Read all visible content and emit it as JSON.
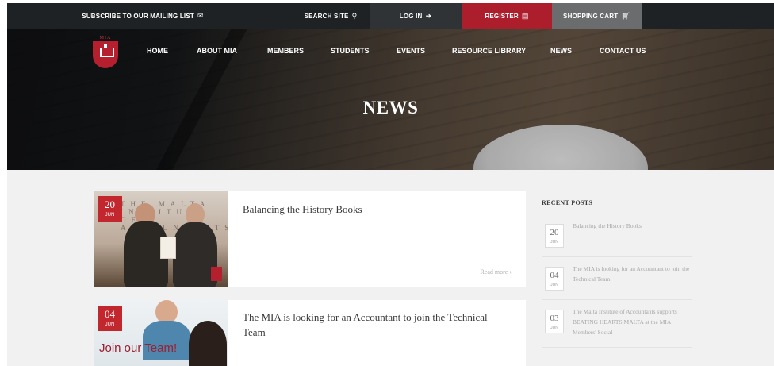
{
  "topbar": {
    "subscribe_label": "SUBSCRIBE TO OUR MAILING LIST",
    "subscribe_icon": "envelope-icon",
    "search_label": "SEARCH SITE",
    "search_icon": "search-icon",
    "login_label": "LOG IN",
    "login_icon": "login-icon",
    "register_label": "REGISTER",
    "register_icon": "id-card-icon",
    "cart_label": "SHOPPING CART",
    "cart_icon": "cart-icon",
    "colors": {
      "bar": "#1f2224",
      "register": "#ad1e2d",
      "cart": "#6a6c6e"
    }
  },
  "logo": {
    "text": "MIA"
  },
  "nav": {
    "items": [
      {
        "label": "HOME"
      },
      {
        "label": "ABOUT MIA"
      },
      {
        "label": "MEMBERS"
      },
      {
        "label": "STUDENTS"
      },
      {
        "label": "EVENTS"
      },
      {
        "label": "RESOURCE LIBRARY"
      },
      {
        "label": "NEWS"
      },
      {
        "label": "CONTACT US"
      }
    ]
  },
  "hero": {
    "title": "NEWS"
  },
  "posts": [
    {
      "day": "20",
      "month": "JUN",
      "title": "Balancing the History Books",
      "read_more": "Read more ›",
      "image_text": "THE MALTA INSTITUTE OF ACCOUNTANTS"
    },
    {
      "day": "04",
      "month": "JUN",
      "title": "The MIA is looking for an Accountant to join the Technical Team",
      "image_text": "Join our Team!"
    }
  ],
  "sidebar": {
    "heading": "RECENT POSTS",
    "items": [
      {
        "day": "20",
        "month": "JUN",
        "title": "Balancing the History Books"
      },
      {
        "day": "04",
        "month": "JUN",
        "title": "The MIA is looking for an Accountant to join the Technical Team"
      },
      {
        "day": "03",
        "month": "JUN",
        "title": "The Malta Institute of Accountants supports BEATING HEARTS MALTA at the MIA Members' Social"
      }
    ]
  },
  "accent_color": "#c1272d"
}
